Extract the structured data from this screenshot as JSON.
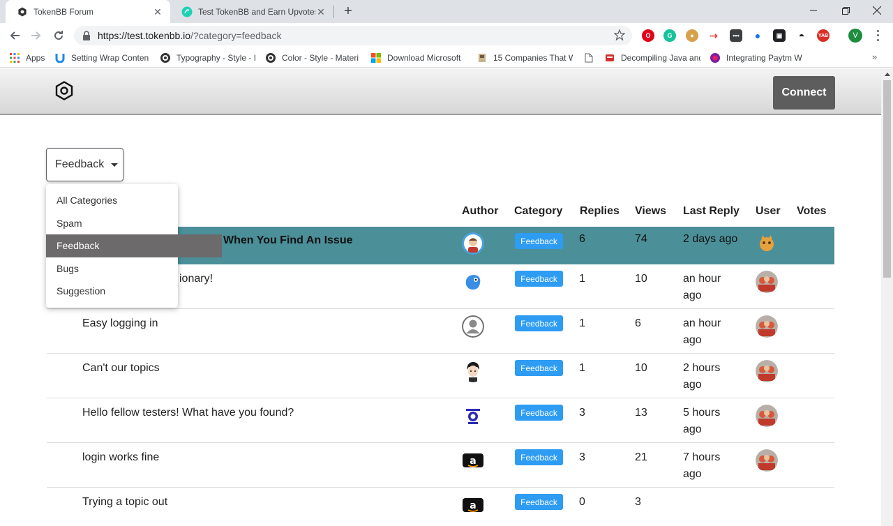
{
  "browser": {
    "tabs": [
      {
        "title": "TokenBB Forum",
        "active": true
      },
      {
        "title": "Test TokenBB and Earn Upvotes! | S",
        "active": false
      }
    ],
    "url_host": "https://test.tokenbb.io",
    "url_path": "/?category=feedback",
    "bookmarks": [
      {
        "label": "Apps",
        "icon": "apps-grid-icon"
      },
      {
        "label": "Setting Wrap Conten",
        "icon": "u-logo-icon"
      },
      {
        "label": "Typography - Style - I",
        "icon": "material-icon"
      },
      {
        "label": "Color - Style - Materi",
        "icon": "material-icon"
      },
      {
        "label": "Download Microsoft",
        "icon": "microsoft-icon"
      },
      {
        "label": "15 Companies That W",
        "icon": "page-thumb-icon"
      },
      {
        "label": "",
        "icon": "document-icon"
      },
      {
        "label": "Decompiling Java and",
        "icon": "red-icon"
      },
      {
        "label": "Integrating Paytm W",
        "icon": "paytm-icon"
      }
    ],
    "profile_initial": "V"
  },
  "header": {
    "connect_label": "Connect"
  },
  "category_select": {
    "value": "Feedback",
    "options": [
      "All Categories",
      "Spam",
      "Feedback",
      "Bugs",
      "Suggestion"
    ],
    "selected_index": 2
  },
  "columns": [
    "Author",
    "Category",
    "Replies",
    "Views",
    "Last Reply",
    "User",
    "Votes"
  ],
  "topics": [
    {
      "title": "When You Find An Issue",
      "category": "Feedback",
      "replies": "6",
      "views": "74",
      "last_reply": "2 days ago",
      "highlight": true
    },
    {
      "title": "ionary!",
      "category": "Feedback",
      "replies": "1",
      "views": "10",
      "last_reply": "an hour ago"
    },
    {
      "title": "Easy logging in",
      "category": "Feedback",
      "replies": "1",
      "views": "6",
      "last_reply": "an hour ago"
    },
    {
      "title": "Can't our topics",
      "category": "Feedback",
      "replies": "1",
      "views": "10",
      "last_reply": "2 hours ago"
    },
    {
      "title": "Hello fellow testers! What have you found?",
      "category": "Feedback",
      "replies": "3",
      "views": "13",
      "last_reply": "5 hours ago"
    },
    {
      "title": "login works fine",
      "category": "Feedback",
      "replies": "3",
      "views": "21",
      "last_reply": "7 hours ago"
    },
    {
      "title": "Trying a topic out",
      "category": "Feedback",
      "replies": "0",
      "views": "3",
      "last_reply": ""
    }
  ]
}
